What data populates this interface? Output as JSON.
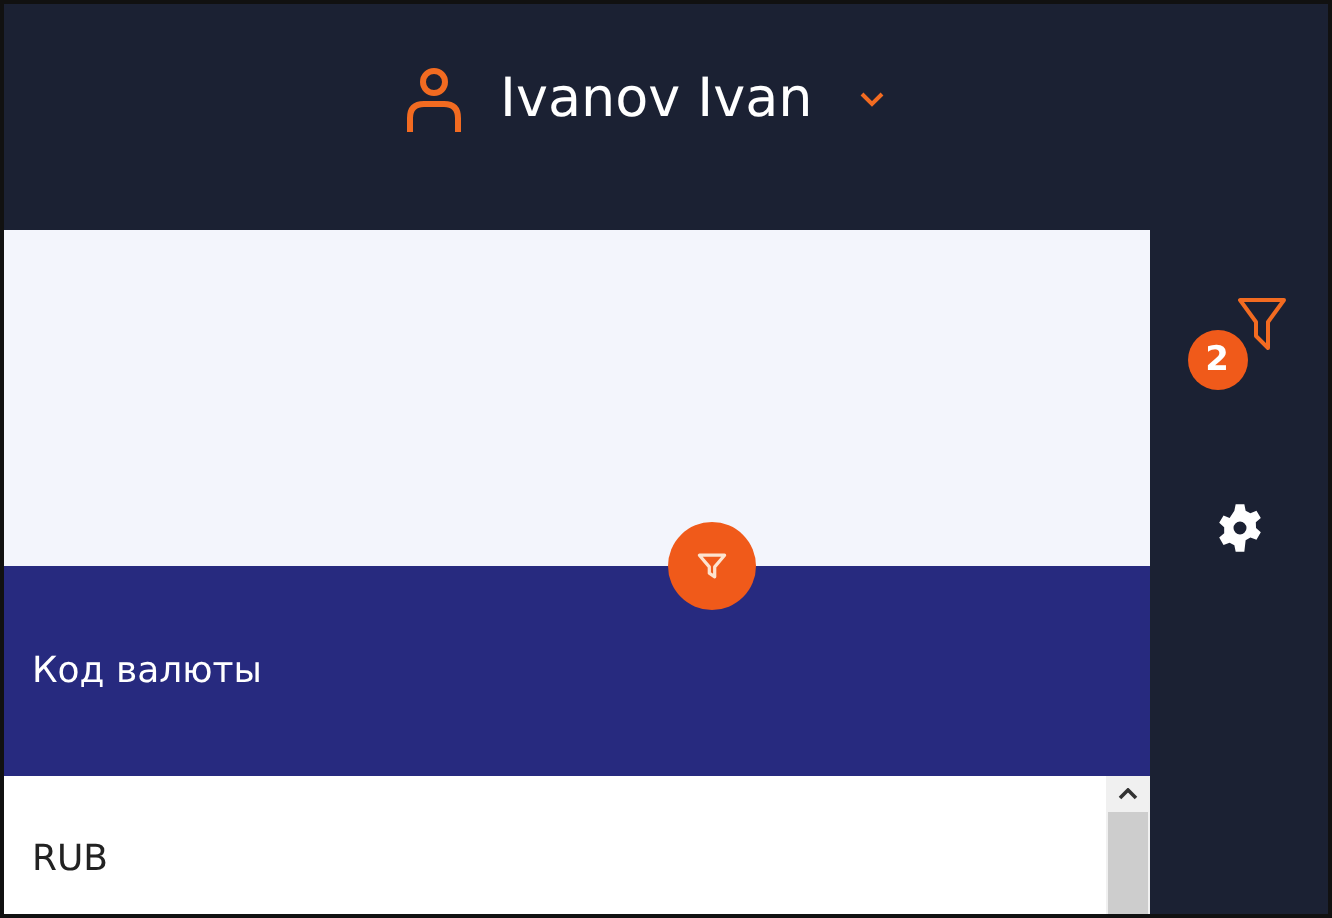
{
  "header": {
    "user_name": "Ivanov Ivan"
  },
  "sidebar": {
    "filter_count": "2"
  },
  "table": {
    "columns": [
      "Код валюты"
    ],
    "rows": [
      [
        "RUB"
      ]
    ]
  }
}
